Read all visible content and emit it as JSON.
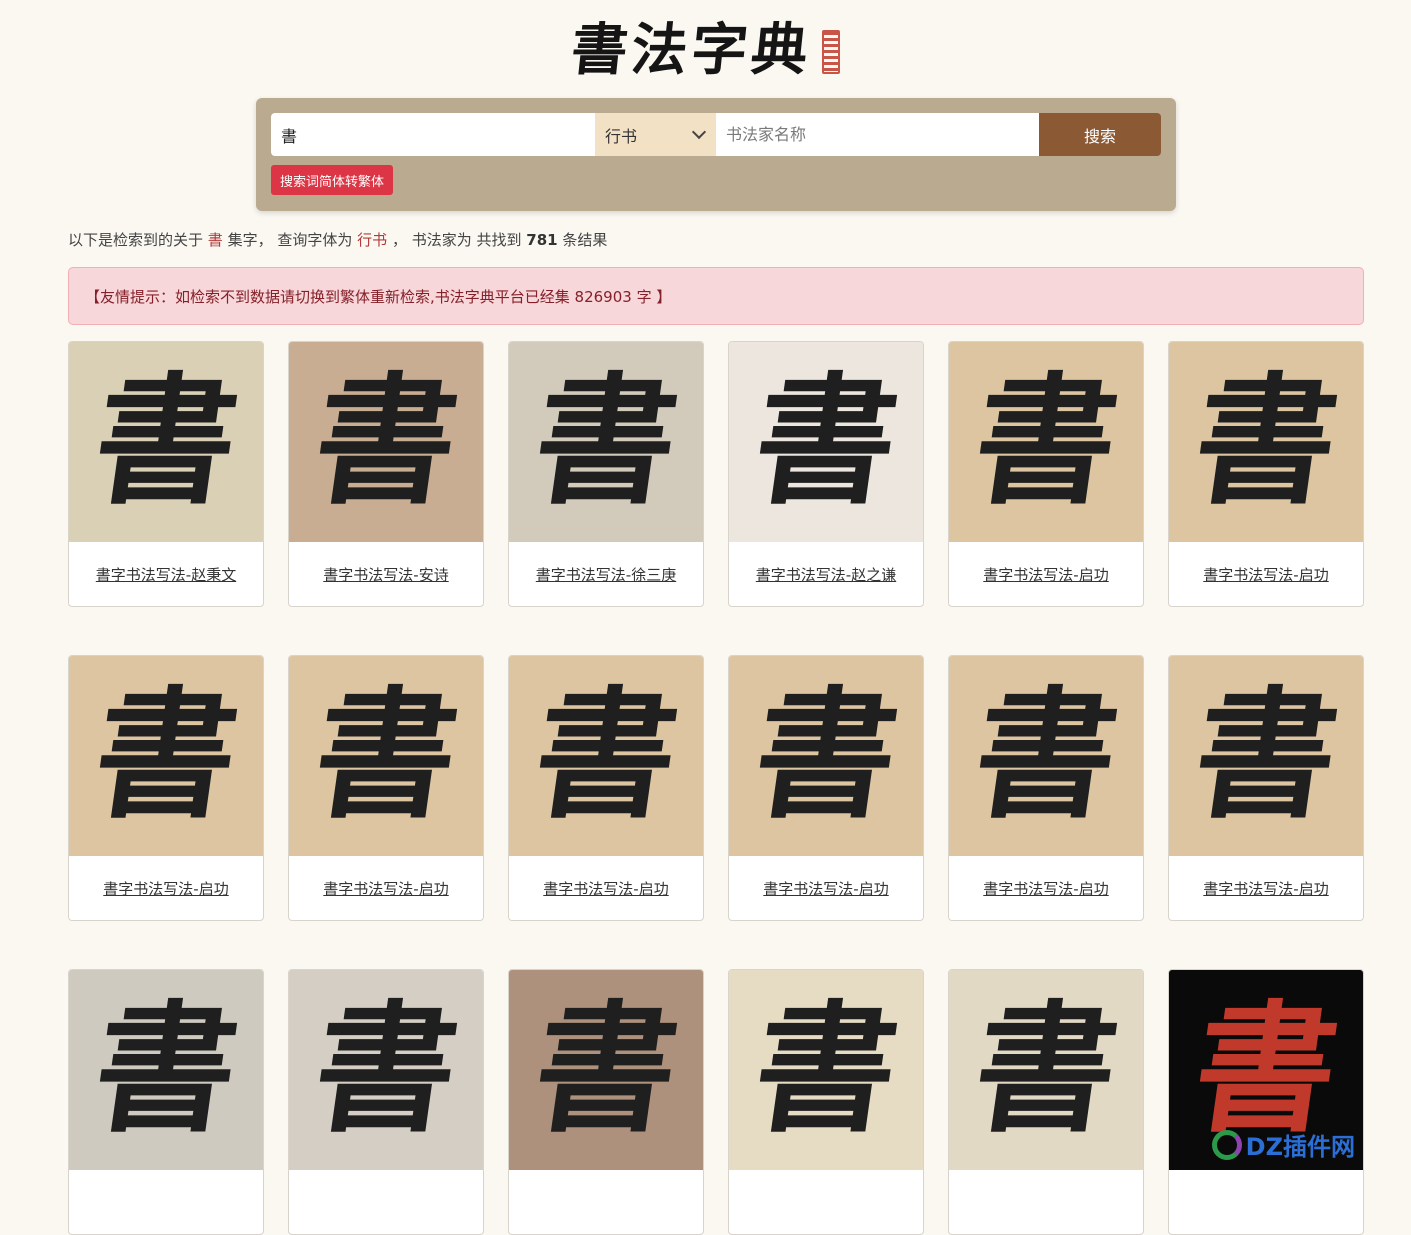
{
  "logo": {
    "text": "書法字典"
  },
  "search": {
    "query_value": "書",
    "style_selected": "行书",
    "author_placeholder": "书法家名称",
    "search_button": "搜索",
    "convert_button": "搜索词简体转繁体"
  },
  "summary": {
    "p1": "以下是检索到的关于",
    "char": "書",
    "p2": "集字， 查询字体为",
    "style": "行书",
    "p3": "， 书法家为 共找到",
    "count": "781",
    "p4": "条结果"
  },
  "alert": {
    "text": "【友情提示：如检索不到数据请切换到繁体重新检索,书法字典平台已经集 826903 字 】"
  },
  "cards": [
    {
      "caption": "書字书法写法-赵秉文",
      "bg": "#d9d0b5"
    },
    {
      "caption": "書字书法写法-安诗",
      "bg": "#c9ad92"
    },
    {
      "caption": "書字书法写法-徐三庚",
      "bg": "#d2cbbb"
    },
    {
      "caption": "書字书法写法-赵之谦",
      "bg": "#ece6de"
    },
    {
      "caption": "書字书法写法-启功",
      "bg": "#dcc5a0"
    },
    {
      "caption": "書字书法写法-启功",
      "bg": "#dcc5a0"
    },
    {
      "caption": "書字书法写法-启功",
      "bg": "#dcc5a0"
    },
    {
      "caption": "書字书法写法-启功",
      "bg": "#dcc5a0"
    },
    {
      "caption": "書字书法写法-启功",
      "bg": "#dcc5a0"
    },
    {
      "caption": "書字书法写法-启功",
      "bg": "#dcc5a0"
    },
    {
      "caption": "書字书法写法-启功",
      "bg": "#dcc5a0"
    },
    {
      "caption": "書字书法写法-启功",
      "bg": "#dcc5a0"
    },
    {
      "caption": "",
      "bg": "#cfcac0"
    },
    {
      "caption": "",
      "bg": "#d4cec4"
    },
    {
      "caption": "",
      "bg": "#ad917c"
    },
    {
      "caption": "",
      "bg": "#e6dcc4"
    },
    {
      "caption": "",
      "bg": "#e1d9c4"
    },
    {
      "caption": "",
      "bg": "#0a0a0a"
    }
  ],
  "glyph_char": "書",
  "watermark": {
    "text": "DZ插件网"
  }
}
